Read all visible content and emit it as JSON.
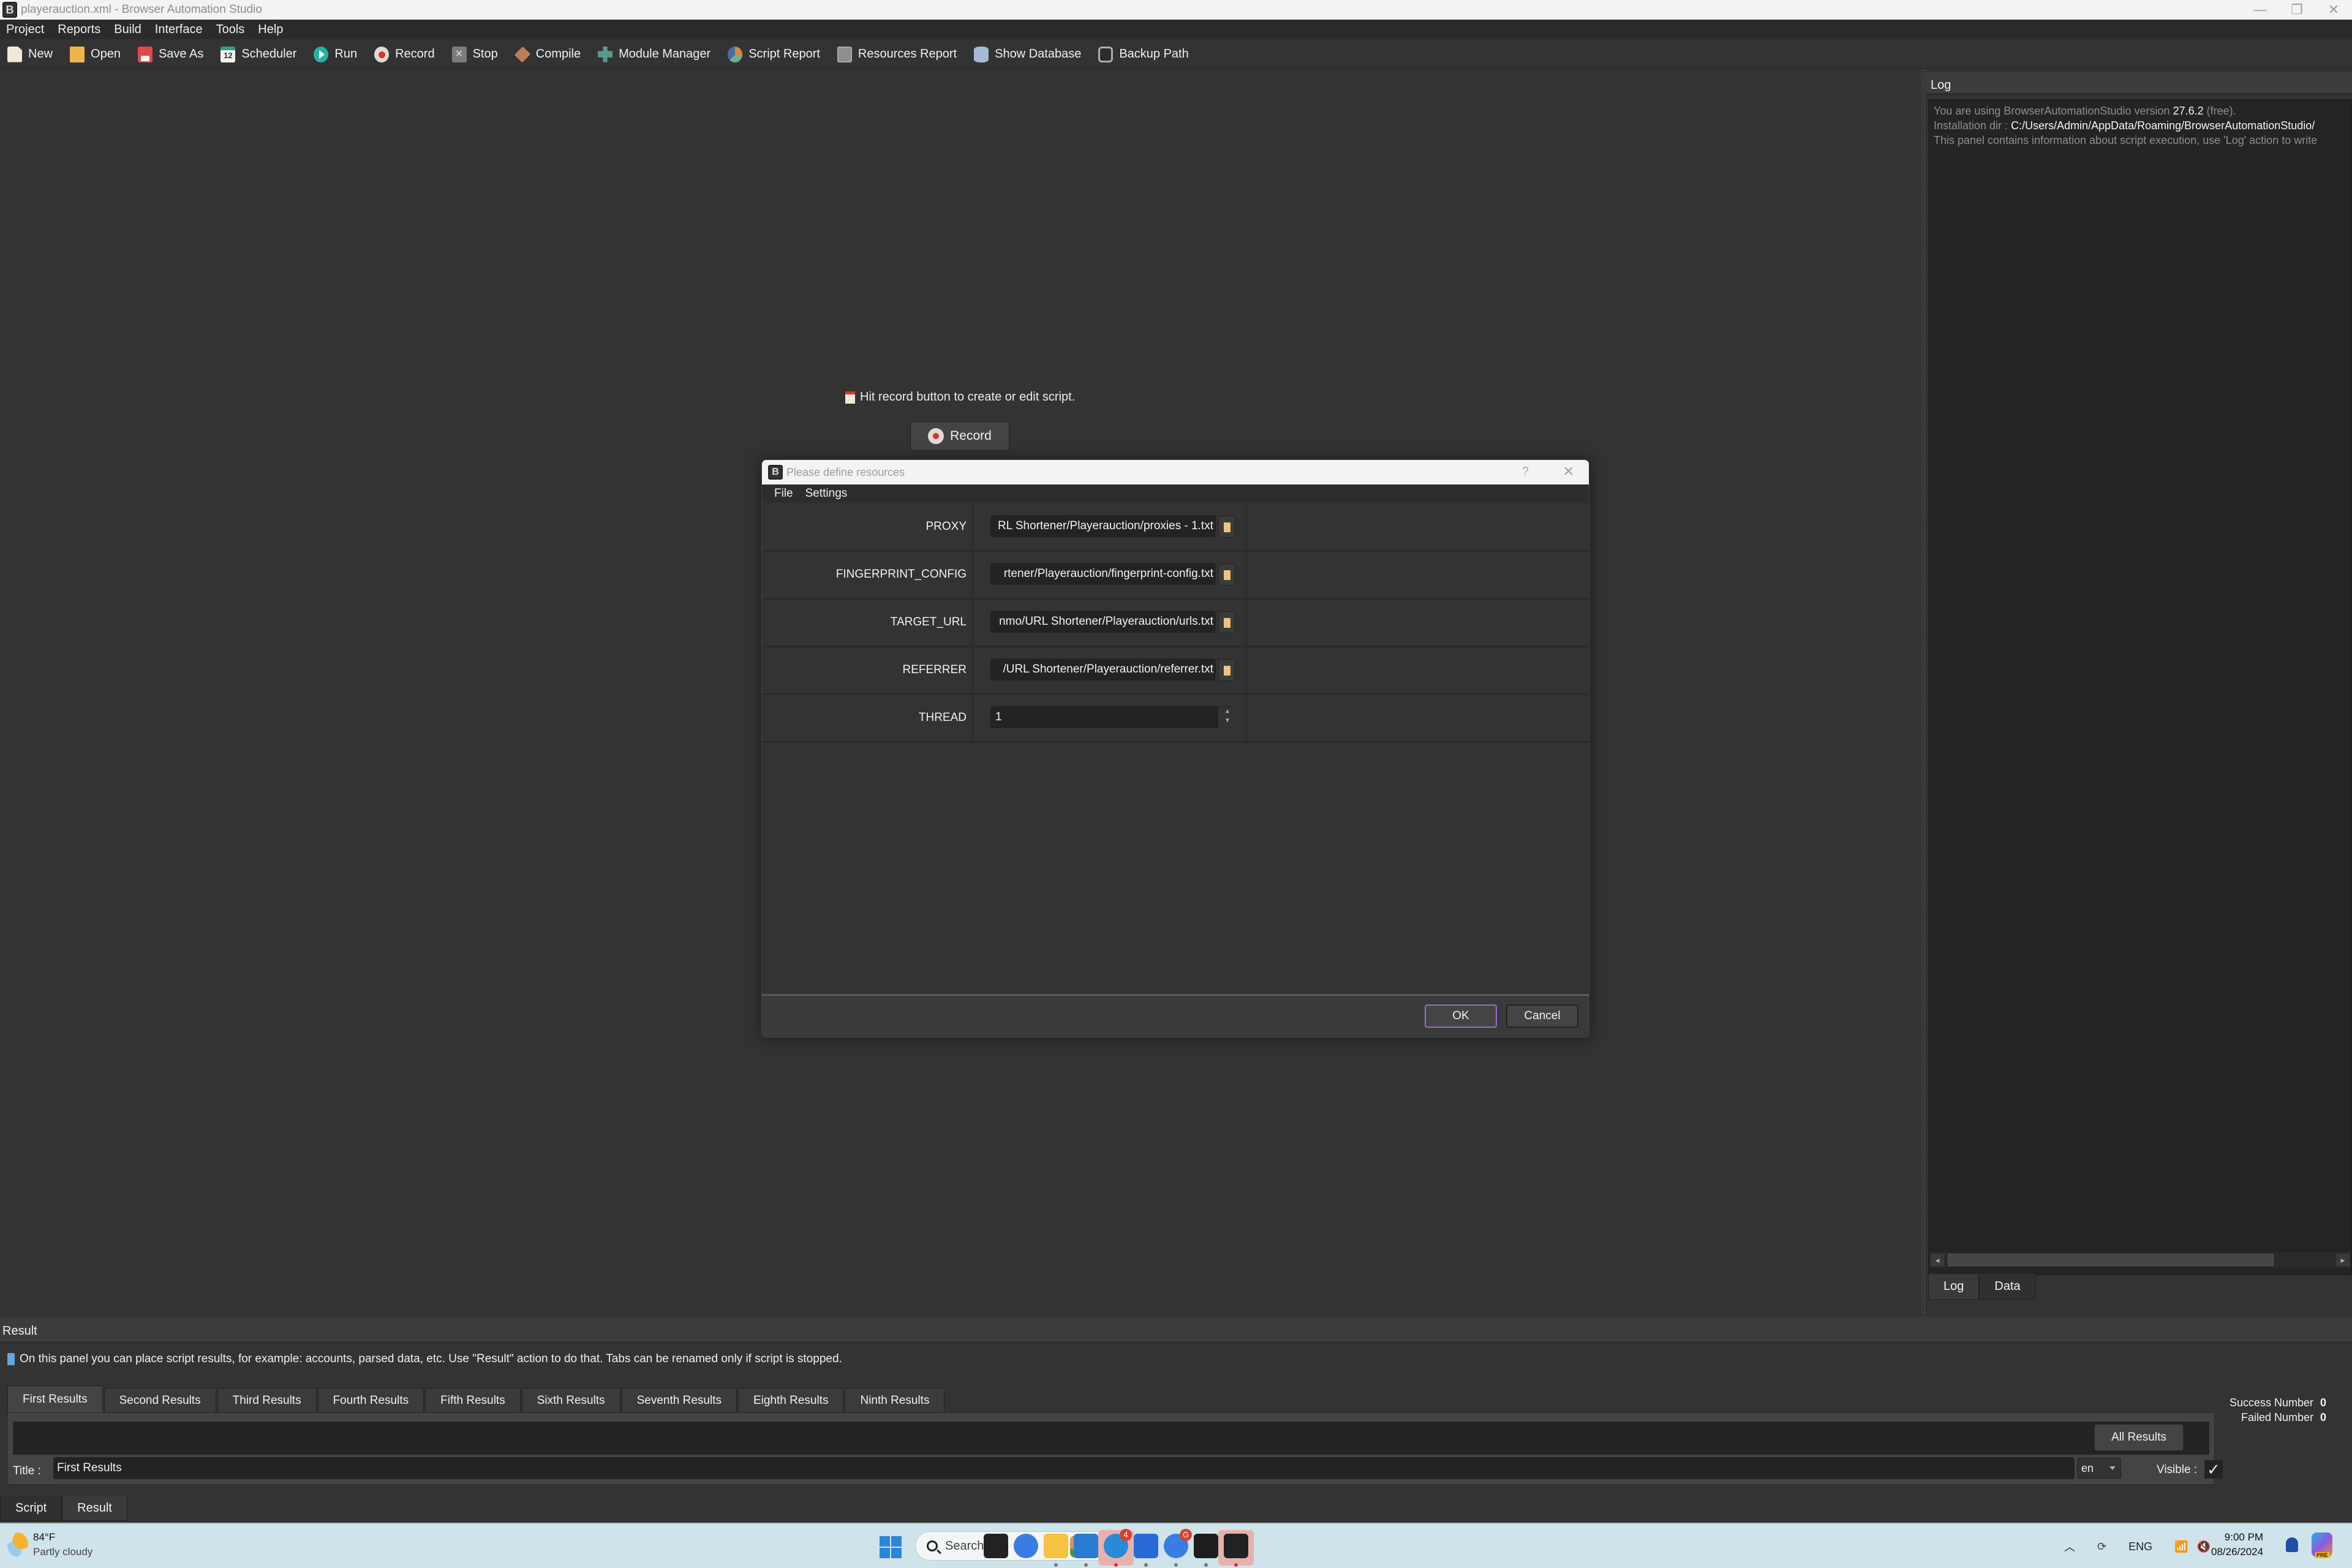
{
  "window": {
    "title": "playerauction.xml - Browser Automation Studio",
    "app_icon_letter": "B",
    "controls": {
      "minimize": "—",
      "restore": "❐",
      "close": "✕"
    }
  },
  "menubar": [
    "Project",
    "Reports",
    "Build",
    "Interface",
    "Tools",
    "Help"
  ],
  "toolbar": [
    {
      "label": "New",
      "icon": "new-file-icon"
    },
    {
      "label": "Open",
      "icon": "open-folder-icon"
    },
    {
      "label": "Save As",
      "icon": "save-disk-icon"
    },
    {
      "label": "Scheduler",
      "icon": "calendar-icon"
    },
    {
      "label": "Run",
      "icon": "play-icon"
    },
    {
      "label": "Record",
      "icon": "record-icon"
    },
    {
      "label": "Stop",
      "icon": "stop-icon"
    },
    {
      "label": "Compile",
      "icon": "box-icon"
    },
    {
      "label": "Module Manager",
      "icon": "puzzle-icon"
    },
    {
      "label": "Script Report",
      "icon": "pie-chart-icon"
    },
    {
      "label": "Resources Report",
      "icon": "document-icon"
    },
    {
      "label": "Show Database",
      "icon": "database-icon"
    },
    {
      "label": "Backup Path",
      "icon": "backup-icon"
    }
  ],
  "main": {
    "hint": "Hit record button to create or edit script.",
    "record_button": "Record"
  },
  "log_panel": {
    "title": "Log",
    "lines": [
      {
        "prefix": "You are using BrowserAutomationStudio version ",
        "highlight": "27.6.2",
        "suffix": " (free)."
      },
      {
        "prefix": "Installation dir : ",
        "highlight": "C:/Users/Admin/AppData/Roaming/BrowserAutomationStudio/",
        "suffix": ""
      },
      {
        "prefix": "This panel contains information about script execution, use 'Log' action to write",
        "highlight": "",
        "suffix": ""
      }
    ],
    "tabs": [
      "Log",
      "Data"
    ],
    "active_tab": "Log"
  },
  "dialog": {
    "title": "Please define resources",
    "help": "?",
    "close": "✕",
    "menu": [
      "File",
      "Settings"
    ],
    "resources": [
      {
        "name": "PROXY",
        "value": "RL Shortener/Playerauction/proxies - 1.txt",
        "type": "file"
      },
      {
        "name": "FINGERPRINT_CONFIG",
        "value": "rtener/Playerauction/fingerprint-config.txt",
        "type": "file"
      },
      {
        "name": "TARGET_URL",
        "value": "nmo/URL Shortener/Playerauction/urls.txt",
        "type": "file"
      },
      {
        "name": "REFERRER",
        "value": "/URL Shortener/Playerauction/referrer.txt",
        "type": "file"
      },
      {
        "name": "THREAD",
        "value": "1",
        "type": "number"
      }
    ],
    "ok": "OK",
    "cancel": "Cancel"
  },
  "result_panel": {
    "title": "Result",
    "info": "On this panel you can place script results, for example: accounts, parsed data, etc. Use \"Result\" action to do that. Tabs can be renamed only if script is stopped.",
    "tabs": [
      "First Results",
      "Second Results",
      "Third Results",
      "Fourth Results",
      "Fifth Results",
      "Sixth Results",
      "Seventh Results",
      "Eighth Results",
      "Ninth Results"
    ],
    "active_tab": "First Results",
    "all_results": "All Results",
    "title_label": "Title :",
    "title_value": "First Results",
    "language": "en",
    "visible_label": "Visible :",
    "visible_checked": true,
    "success_label": "Success Number",
    "success_value": "0",
    "failed_label": "Failed Number",
    "failed_value": "0"
  },
  "bottom_tabs": [
    "Script",
    "Result"
  ],
  "taskbar": {
    "weather_temp": "84°F",
    "weather_condition": "Partly cloudy",
    "search_placeholder": "Search",
    "apps": [
      {
        "name": "task-view",
        "color": "#222222",
        "running": false
      },
      {
        "name": "chrome",
        "color": "#3a7de0",
        "running": false
      },
      {
        "name": "file-explorer",
        "color": "#f5c242",
        "running": true
      },
      {
        "name": "vscode",
        "color": "#2a7bd4",
        "running": true
      },
      {
        "name": "telegram",
        "color": "#2a8ad8",
        "running": true,
        "badge": "4",
        "highlighted": true
      },
      {
        "name": "app-check",
        "color": "#2a6ad8",
        "running": true
      },
      {
        "name": "chrome-profile",
        "color": "#3a7de0",
        "running": true,
        "badge": "G"
      },
      {
        "name": "figma",
        "color": "#1e1e1e",
        "running": true
      },
      {
        "name": "browser-automation-studio",
        "color": "#222222",
        "running": true,
        "highlighted": true
      }
    ],
    "tray": {
      "language": "ENG"
    },
    "time": "9:00 PM",
    "date": "08/26/2024",
    "copilot_badge": "PRE"
  }
}
